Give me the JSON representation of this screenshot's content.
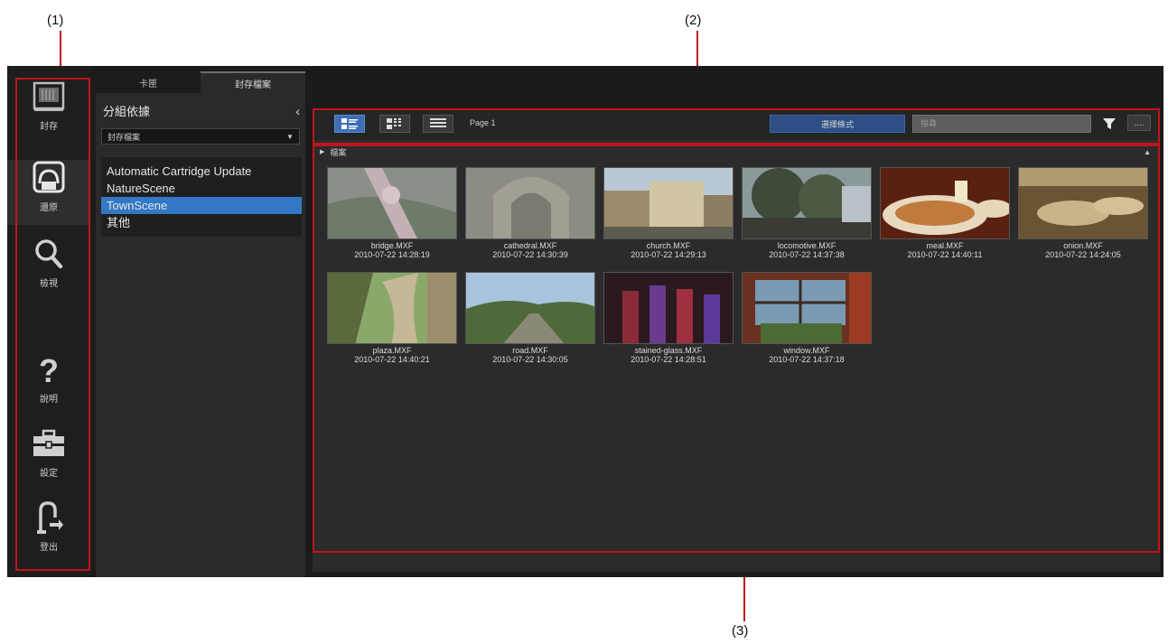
{
  "callouts": {
    "one": "(1)",
    "two": "(2)",
    "three": "(3)"
  },
  "rail": [
    {
      "label": "封存",
      "icon": "archive-icon"
    },
    {
      "label": "還原",
      "icon": "restore-icon"
    },
    {
      "label": "檢視",
      "icon": "search-icon"
    },
    {
      "label": "說明",
      "icon": "help-icon"
    },
    {
      "label": "設定",
      "icon": "settings-toolbox-icon"
    },
    {
      "label": "登出",
      "icon": "logout-icon"
    }
  ],
  "sidepanel": {
    "tabs": [
      "卡匣",
      "封存檔案"
    ],
    "group_title": "分組依據",
    "dropdown_value": "封存檔案",
    "categories": [
      "Automatic Cartridge Update",
      "NatureScene",
      "TownScene",
      "其他"
    ],
    "selected_category": 2
  },
  "toolbar": {
    "page": "Page 1",
    "sort_label": "選擇條式",
    "search_placeholder": "搜尋",
    "more_label": "...."
  },
  "group_label": "檔案",
  "files": [
    {
      "name": "bridge.MXF",
      "date": "2010-07-22 14:28:19"
    },
    {
      "name": "cathedral.MXF",
      "date": "2010-07-22 14:30:39"
    },
    {
      "name": "church.MXF",
      "date": "2010-07-22 14:29:13"
    },
    {
      "name": "locomotive.MXF",
      "date": "2010-07-22 14:37:38"
    },
    {
      "name": "meal.MXF",
      "date": "2010-07-22 14:40:11"
    },
    {
      "name": "onion.MXF",
      "date": "2010-07-22 14:24:05"
    },
    {
      "name": "plaza.MXF",
      "date": "2010-07-22 14:40:21"
    },
    {
      "name": "road.MXF",
      "date": "2010-07-22 14:30:05"
    },
    {
      "name": "stained-glass.MXF",
      "date": "2010-07-22 14:28:51"
    },
    {
      "name": "window.MXF",
      "date": "2010-07-22 14:37:18"
    }
  ],
  "colors": {
    "accent": "#3478c5",
    "highlight": "#c0141b",
    "sort_button": "#2d4f86"
  }
}
